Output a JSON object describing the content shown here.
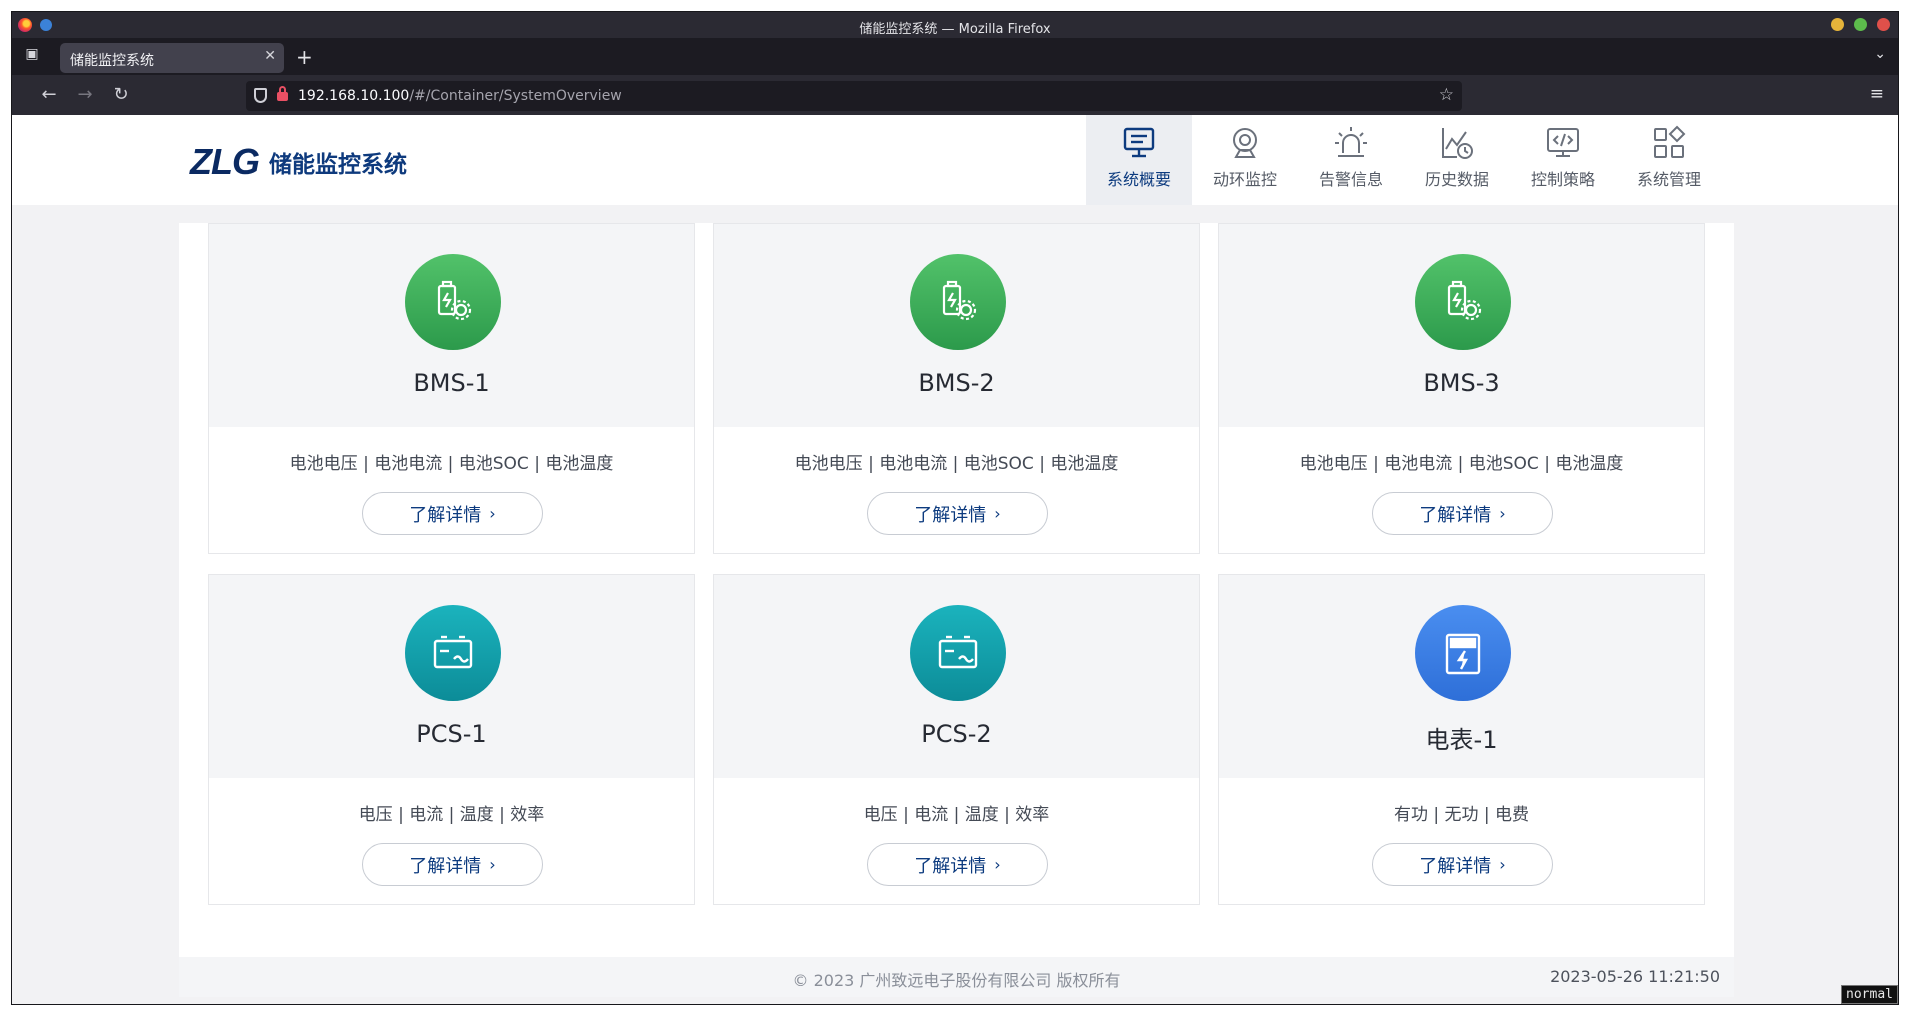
{
  "browser": {
    "window_title": "储能监控系统 — Mozilla Firefox",
    "tab_title": "储能监控系统",
    "url_host": "192.168.10.100",
    "url_path": "/#/Container/SystemOverview"
  },
  "header": {
    "logo_mark": "ZLG",
    "logo_text": "储能监控系统"
  },
  "menu": [
    {
      "label": "系统概要",
      "icon": "monitor-icon",
      "active": true
    },
    {
      "label": "动环监控",
      "icon": "webcam-icon",
      "active": false
    },
    {
      "label": "告警信息",
      "icon": "alarm-icon",
      "active": false
    },
    {
      "label": "历史数据",
      "icon": "history-chart-icon",
      "active": false
    },
    {
      "label": "控制策略",
      "icon": "code-screen-icon",
      "active": false
    },
    {
      "label": "系统管理",
      "icon": "grid-icon",
      "active": false
    }
  ],
  "cards": [
    {
      "name": "BMS-1",
      "desc": "电池电压 | 电池电流 | 电池SOC | 电池温度",
      "button": "了解详情",
      "icon": "battery-gear-icon",
      "color": "#3aad58"
    },
    {
      "name": "BMS-2",
      "desc": "电池电压 | 电池电流 | 电池SOC | 电池温度",
      "button": "了解详情",
      "icon": "battery-gear-icon",
      "color": "#3aad58"
    },
    {
      "name": "BMS-3",
      "desc": "电池电压 | 电池电流 | 电池SOC | 电池温度",
      "button": "了解详情",
      "icon": "battery-gear-icon",
      "color": "#3aad58"
    },
    {
      "name": "PCS-1",
      "desc": "电压 | 电流 | 温度 | 效率",
      "button": "了解详情",
      "icon": "converter-icon",
      "color": "#10a0aa"
    },
    {
      "name": "PCS-2",
      "desc": "电压 | 电流 | 温度 | 效率",
      "button": "了解详情",
      "icon": "converter-icon",
      "color": "#10a0aa"
    },
    {
      "name": "电表-1",
      "desc": "有功 | 无功 | 电费",
      "button": "了解详情",
      "icon": "meter-icon",
      "color": "#3a7fe6"
    }
  ],
  "footer": {
    "copyright": "© 2023 广州致远电子股份有限公司 版权所有",
    "datetime": "2023-05-26 11:21:50"
  },
  "overlay": {
    "mode": "normal"
  }
}
